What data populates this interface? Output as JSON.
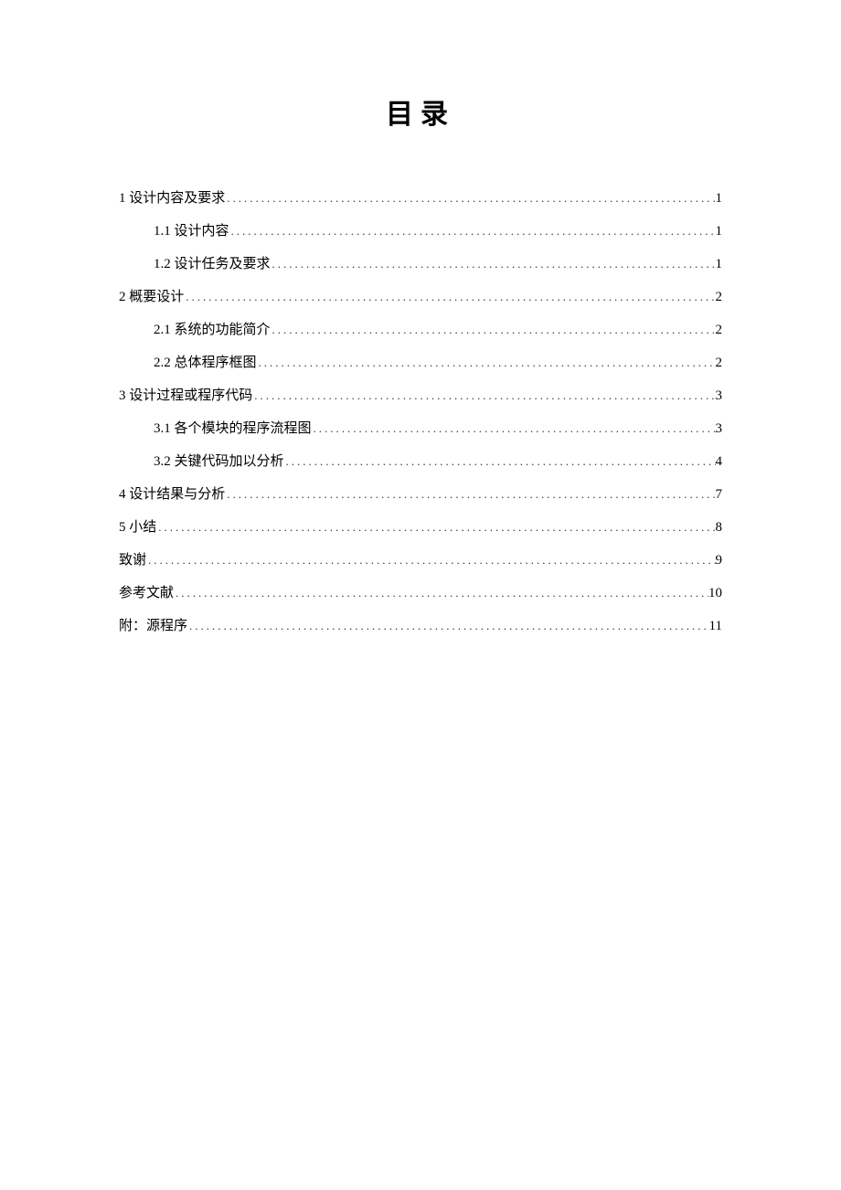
{
  "title": "目录",
  "toc": {
    "entries": [
      {
        "level": 1,
        "label": "1 设计内容及要求",
        "page": "1"
      },
      {
        "level": 2,
        "label": "1.1 设计内容",
        "page": "1"
      },
      {
        "level": 2,
        "label": "1.2 设计任务及要求",
        "page": "1"
      },
      {
        "level": 1,
        "label": "2 概要设计",
        "page": "2"
      },
      {
        "level": 2,
        "label": "2.1 系统的功能简介",
        "page": "2"
      },
      {
        "level": 2,
        "label": "2.2 总体程序框图",
        "page": "2"
      },
      {
        "level": 1,
        "label": "3 设计过程或程序代码",
        "page": "3"
      },
      {
        "level": 2,
        "label": "3.1 各个模块的程序流程图",
        "page": "3"
      },
      {
        "level": 2,
        "label": "3.2 关键代码加以分析",
        "page": "4"
      },
      {
        "level": 1,
        "label": "4 设计结果与分析",
        "page": "7"
      },
      {
        "level": 1,
        "label": "5 小结",
        "page": "8"
      },
      {
        "level": 1,
        "label": "致谢",
        "page": "9"
      },
      {
        "level": 1,
        "label": "参考文献",
        "page": "10"
      },
      {
        "level": 1,
        "label": "附：源程序",
        "page": "11"
      }
    ]
  }
}
